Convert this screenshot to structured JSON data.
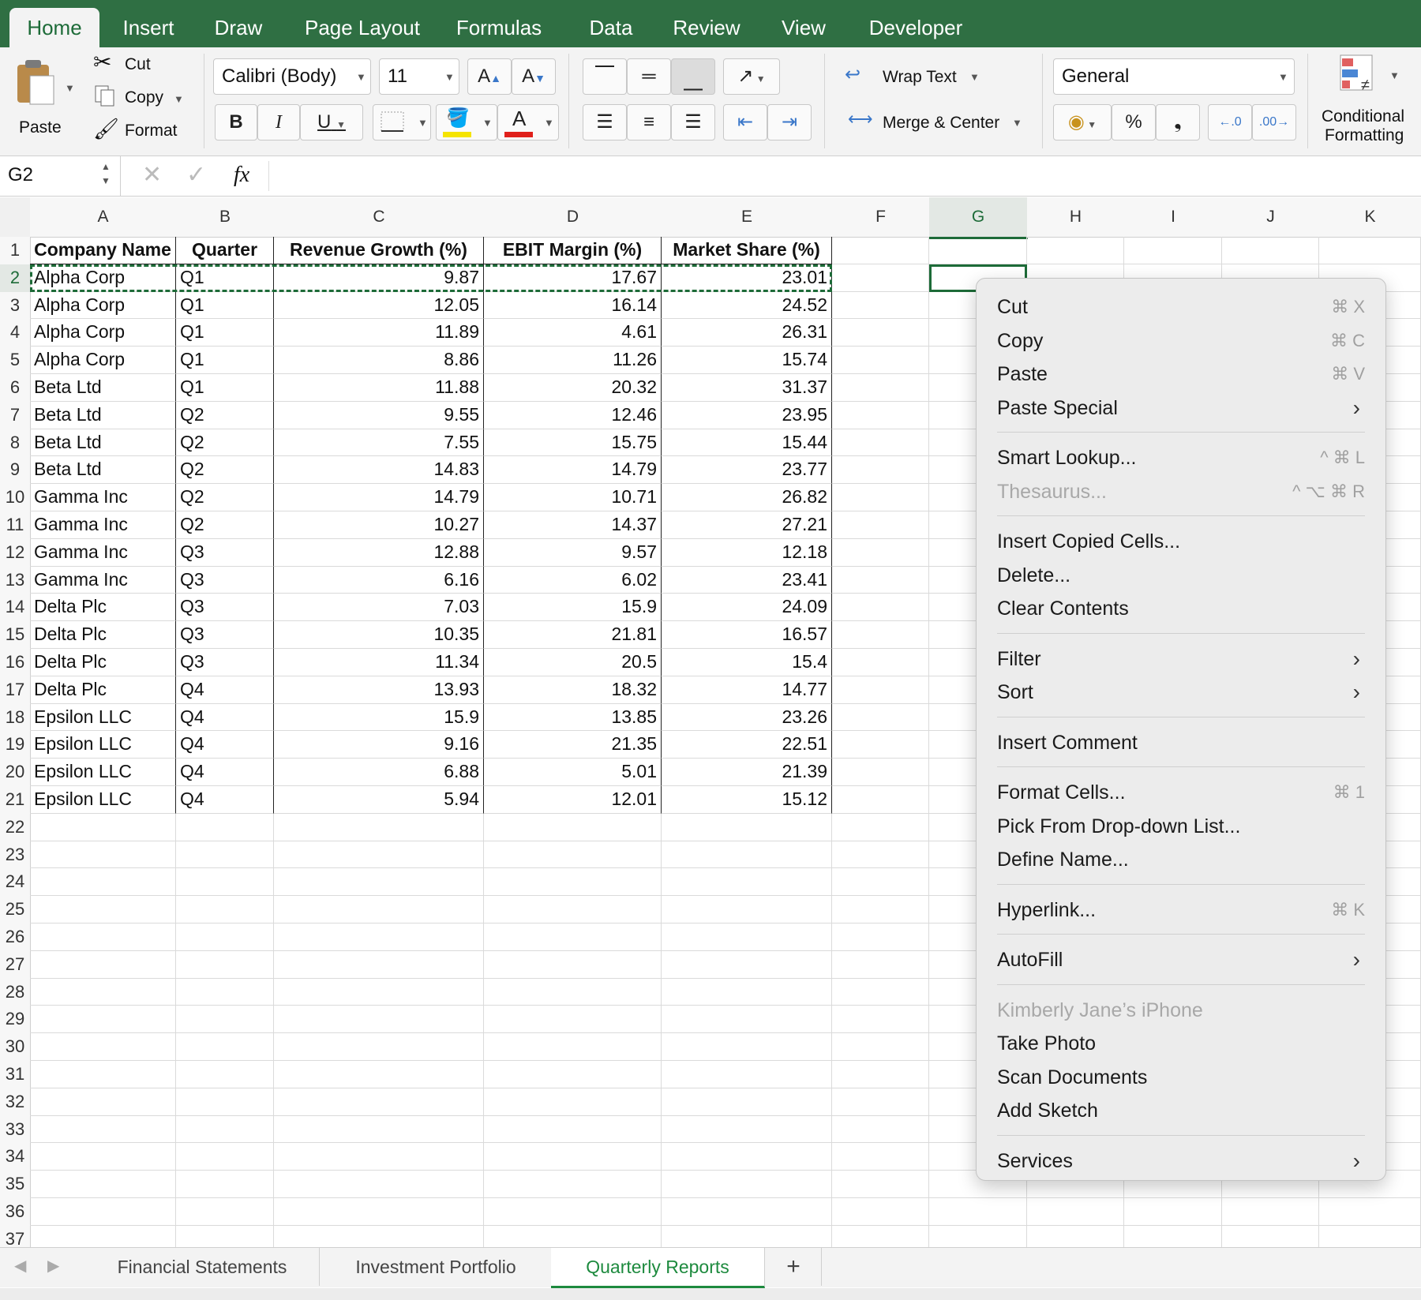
{
  "ribbon_tabs": [
    "Home",
    "Insert",
    "Draw",
    "Page Layout",
    "Formulas",
    "Data",
    "Review",
    "View",
    "Developer"
  ],
  "clipboard": {
    "paste": "Paste",
    "cut": "Cut",
    "copy": "Copy",
    "format": "Format"
  },
  "font": {
    "name": "Calibri (Body)",
    "size": "11",
    "bold": "B",
    "italic": "I",
    "underline": "U",
    "grow": "A",
    "shrink": "A",
    "font_color_letter": "A"
  },
  "alignment": {
    "wrap_text": "Wrap Text",
    "merge_center": "Merge & Center"
  },
  "number": {
    "format": "General",
    "percent": "%",
    "comma": "❟"
  },
  "styles": {
    "conditional_formatting_line1": "Conditional",
    "conditional_formatting_line2": "Formatting"
  },
  "formula_bar": {
    "name_box": "G2",
    "fx": "fx",
    "value": ""
  },
  "columns": [
    "A",
    "B",
    "C",
    "D",
    "E",
    "F",
    "G",
    "H",
    "I",
    "J",
    "K"
  ],
  "selected_column": "G",
  "rows": {
    "count": 37,
    "selected": 2
  },
  "table": {
    "headers": [
      "Company Name",
      "Quarter",
      "Revenue Growth (%)",
      "EBIT Margin (%)",
      "Market Share (%)"
    ],
    "data": [
      [
        "Alpha Corp",
        "Q1",
        "9.87",
        "17.67",
        "23.01"
      ],
      [
        "Alpha Corp",
        "Q1",
        "12.05",
        "16.14",
        "24.52"
      ],
      [
        "Alpha Corp",
        "Q1",
        "11.89",
        "4.61",
        "26.31"
      ],
      [
        "Alpha Corp",
        "Q1",
        "8.86",
        "11.26",
        "15.74"
      ],
      [
        "Beta Ltd",
        "Q1",
        "11.88",
        "20.32",
        "31.37"
      ],
      [
        "Beta Ltd",
        "Q2",
        "9.55",
        "12.46",
        "23.95"
      ],
      [
        "Beta Ltd",
        "Q2",
        "7.55",
        "15.75",
        "15.44"
      ],
      [
        "Beta Ltd",
        "Q2",
        "14.83",
        "14.79",
        "23.77"
      ],
      [
        "Gamma Inc",
        "Q2",
        "14.79",
        "10.71",
        "26.82"
      ],
      [
        "Gamma Inc",
        "Q2",
        "10.27",
        "14.37",
        "27.21"
      ],
      [
        "Gamma Inc",
        "Q3",
        "12.88",
        "9.57",
        "12.18"
      ],
      [
        "Gamma Inc",
        "Q3",
        "6.16",
        "6.02",
        "23.41"
      ],
      [
        "Delta Plc",
        "Q3",
        "7.03",
        "15.9",
        "24.09"
      ],
      [
        "Delta Plc",
        "Q3",
        "10.35",
        "21.81",
        "16.57"
      ],
      [
        "Delta Plc",
        "Q3",
        "11.34",
        "20.5",
        "15.4"
      ],
      [
        "Delta Plc",
        "Q4",
        "13.93",
        "18.32",
        "14.77"
      ],
      [
        "Epsilon LLC",
        "Q4",
        "15.9",
        "13.85",
        "23.26"
      ],
      [
        "Epsilon LLC",
        "Q4",
        "9.16",
        "21.35",
        "22.51"
      ],
      [
        "Epsilon LLC",
        "Q4",
        "6.88",
        "5.01",
        "21.39"
      ],
      [
        "Epsilon LLC",
        "Q4",
        "5.94",
        "12.01",
        "15.12"
      ]
    ]
  },
  "context_menu": [
    {
      "label": "Cut",
      "shortcut": "⌘ X"
    },
    {
      "label": "Copy",
      "shortcut": "⌘ C"
    },
    {
      "label": "Paste",
      "shortcut": "⌘ V"
    },
    {
      "label": "Paste Special",
      "submenu": true
    },
    {
      "sep": true
    },
    {
      "label": "Smart Lookup...",
      "shortcut": "^ ⌘ L"
    },
    {
      "label": "Thesaurus...",
      "shortcut": "^ ⌥ ⌘ R",
      "disabled": true
    },
    {
      "sep": true
    },
    {
      "label": "Insert Copied Cells..."
    },
    {
      "label": "Delete..."
    },
    {
      "label": "Clear Contents"
    },
    {
      "sep": true
    },
    {
      "label": "Filter",
      "submenu": true
    },
    {
      "label": "Sort",
      "submenu": true
    },
    {
      "sep": true
    },
    {
      "label": "Insert Comment"
    },
    {
      "sep": true
    },
    {
      "label": "Format Cells...",
      "shortcut": "⌘ 1"
    },
    {
      "label": "Pick From Drop-down List..."
    },
    {
      "label": "Define Name..."
    },
    {
      "sep": true
    },
    {
      "label": "Hyperlink...",
      "shortcut": "⌘ K"
    },
    {
      "sep": true
    },
    {
      "label": "AutoFill",
      "submenu": true
    },
    {
      "sep": true
    },
    {
      "label": "Kimberly Jane’s iPhone",
      "disabled": true
    },
    {
      "label": "Take Photo"
    },
    {
      "label": "Scan Documents"
    },
    {
      "label": "Add Sketch"
    },
    {
      "sep": true
    },
    {
      "label": "Services",
      "submenu": true
    }
  ],
  "sheet_tabs": [
    "Financial Statements",
    "Investment Portfolio",
    "Quarterly Reports"
  ],
  "active_sheet": "Quarterly Reports",
  "add_sheet": "+",
  "colors": {
    "ribbon": "#2f6f43",
    "accent": "#1d8a3e",
    "copy_marquee": "#1d6b38",
    "fill_yellow": "#f5e400",
    "font_red": "#e0201b"
  }
}
